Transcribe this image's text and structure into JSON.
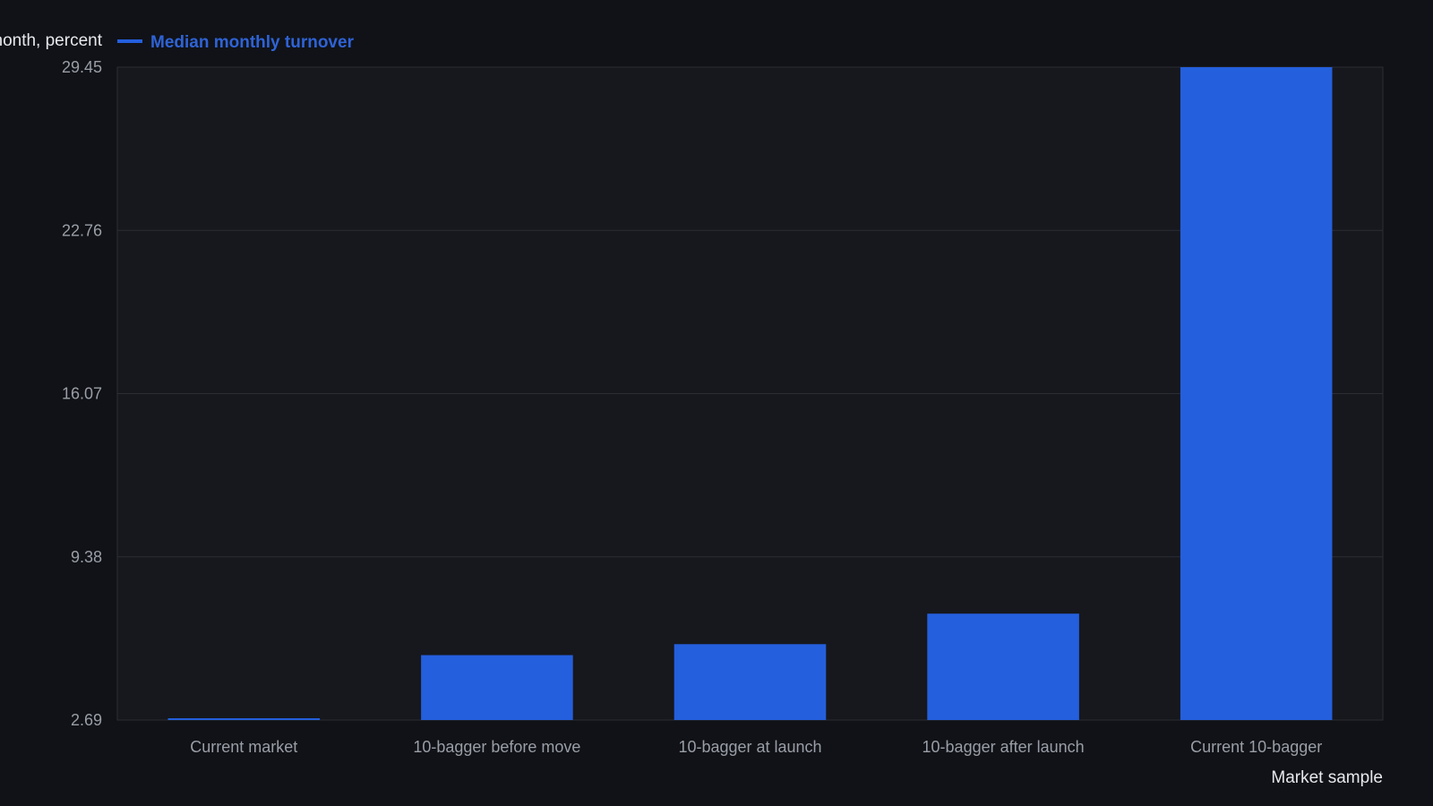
{
  "chart_data": {
    "type": "bar",
    "title": "",
    "xlabel": "Market sample",
    "ylabel": "nonth, percent",
    "categories": [
      "Current market",
      "10-bagger before move",
      "10-bagger at launch",
      "10-bagger after launch",
      "Current 10-bagger"
    ],
    "series": [
      {
        "name": "Median monthly turnover",
        "values": [
          2.69,
          5.35,
          5.8,
          7.05,
          29.45
        ]
      }
    ],
    "ylim": [
      2.69,
      29.45
    ],
    "yticks": [
      "2.69",
      "9.38",
      "16.07",
      "22.76",
      "29.45"
    ],
    "grid": true,
    "legend": "top-left",
    "colors": {
      "bar": "#245fdd",
      "legend_text": "#2f63d6",
      "background": "#101217",
      "plot_background": "#16181d",
      "grid": "#2a2d34"
    }
  }
}
